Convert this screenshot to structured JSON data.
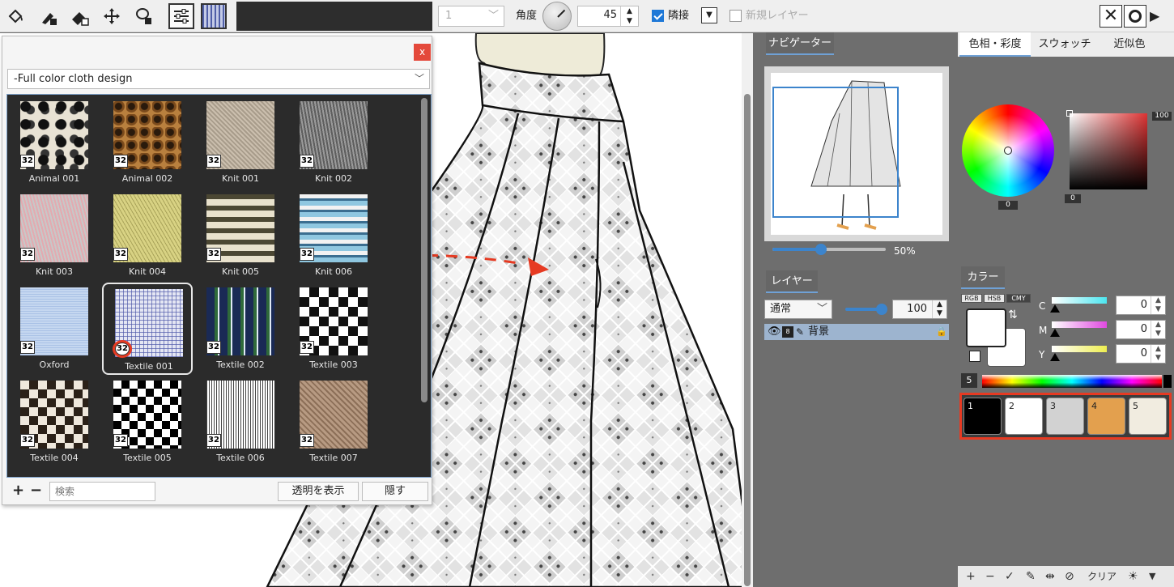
{
  "toolbar": {
    "brush_size": "1",
    "angle_label": "角度",
    "angle_value": "45",
    "adjacent_label": "隣接",
    "adjacent_checked": true,
    "new_layer_label": "新規レイヤー",
    "new_layer_checked": false
  },
  "palette": {
    "close_label": "x",
    "category": "-Full color cloth design",
    "search_placeholder": "検索",
    "show_transparent_label": "透明を表示",
    "hide_label": "隠す",
    "add_label": "+",
    "remove_label": "−",
    "items": [
      {
        "name": "Animal 001",
        "badge": "32"
      },
      {
        "name": "Animal 002",
        "badge": "32"
      },
      {
        "name": "Knit 001",
        "badge": "32"
      },
      {
        "name": "Knit 002",
        "badge": "32"
      },
      {
        "name": "Knit 003",
        "badge": "32"
      },
      {
        "name": "Knit 004",
        "badge": "32"
      },
      {
        "name": "Knit 005",
        "badge": "32"
      },
      {
        "name": "Knit 006",
        "badge": "32"
      },
      {
        "name": "Oxford",
        "badge": "32"
      },
      {
        "name": "Textile 001",
        "badge": "32"
      },
      {
        "name": "Textile 002",
        "badge": "32"
      },
      {
        "name": "Textile 003",
        "badge": "32"
      },
      {
        "name": "Textile 004",
        "badge": "32"
      },
      {
        "name": "Textile 005",
        "badge": "32"
      },
      {
        "name": "Textile 006",
        "badge": "32"
      },
      {
        "name": "Textile 007",
        "badge": "32"
      }
    ],
    "selected_index": 9
  },
  "navigator": {
    "tab_label": "ナビゲーター",
    "zoom_text": "50%",
    "zoom_fraction": 0.5
  },
  "layers": {
    "tab_label": "レイヤー",
    "blend_mode": "通常",
    "opacity": "100",
    "layer_name": "背景"
  },
  "hue_panel": {
    "tabs": [
      "色相・彩度",
      "スウォッチ",
      "近似色"
    ],
    "brightness_value": "100",
    "saturation_value": "0",
    "hue_value": "0"
  },
  "color_panel": {
    "tab_label": "カラー",
    "modes": [
      "RGB",
      "HSB",
      "CMY"
    ],
    "active_mode": "CMY",
    "channels": [
      {
        "label": "C",
        "value": "0"
      },
      {
        "label": "M",
        "value": "0"
      },
      {
        "label": "Y",
        "value": "0"
      }
    ],
    "swatch_count": "5",
    "clear_label": "クリア",
    "swatches": [
      {
        "index": "1",
        "color": "#000000"
      },
      {
        "index": "2",
        "color": "#ffffff"
      },
      {
        "index": "3",
        "color": "#d2d2d2"
      },
      {
        "index": "4",
        "color": "#e3a04e"
      },
      {
        "index": "5",
        "color": "#f1ece0"
      }
    ]
  },
  "colors": {
    "accent_blue": "#3c84cc",
    "highlight_red": "#e63a22",
    "panel_gray": "#6e6e6e"
  }
}
